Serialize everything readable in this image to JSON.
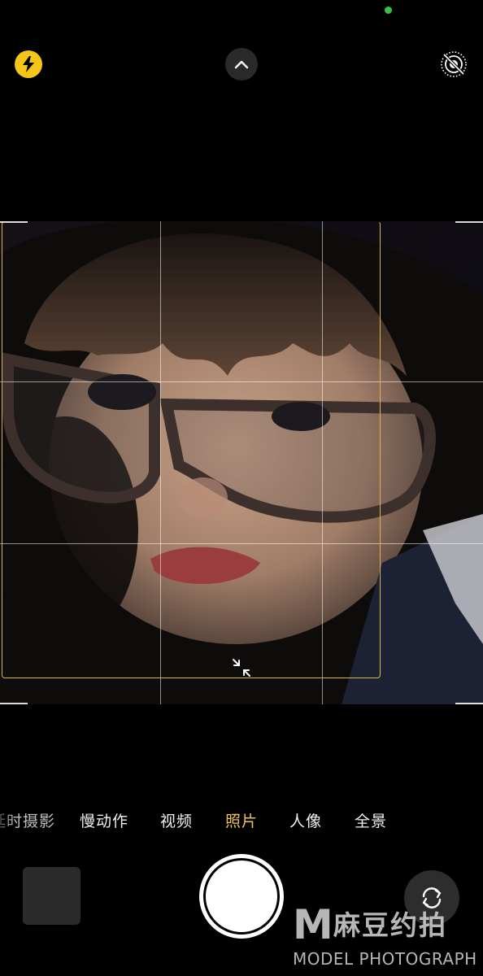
{
  "top_bar": {
    "flash_icon": "lightning-bolt-icon",
    "expand_icon": "chevron-up-icon",
    "live_photo_icon": "live-photo-off-icon",
    "indicator_color": "#35c24b",
    "flash_color": "#f5c518"
  },
  "viewfinder": {
    "grid": "3x3",
    "focus_color": "#d9b44a",
    "shrink_icon": "shrink-arrows-icon"
  },
  "modes": {
    "items": [
      {
        "label": "延时摄影"
      },
      {
        "label": "慢动作"
      },
      {
        "label": "视频"
      },
      {
        "label": "照片",
        "active": true
      },
      {
        "label": "人像"
      },
      {
        "label": "全景"
      }
    ],
    "active_color": "#f0c35a"
  },
  "controls": {
    "thumbnail_icon": "last-photo-thumbnail",
    "shutter_icon": "shutter-button",
    "flip_icon": "camera-flip-icon"
  },
  "watermark": {
    "logo_letter": "M",
    "cn": "麻豆约拍",
    "en": "MODEL PHOTOGRAPH"
  }
}
